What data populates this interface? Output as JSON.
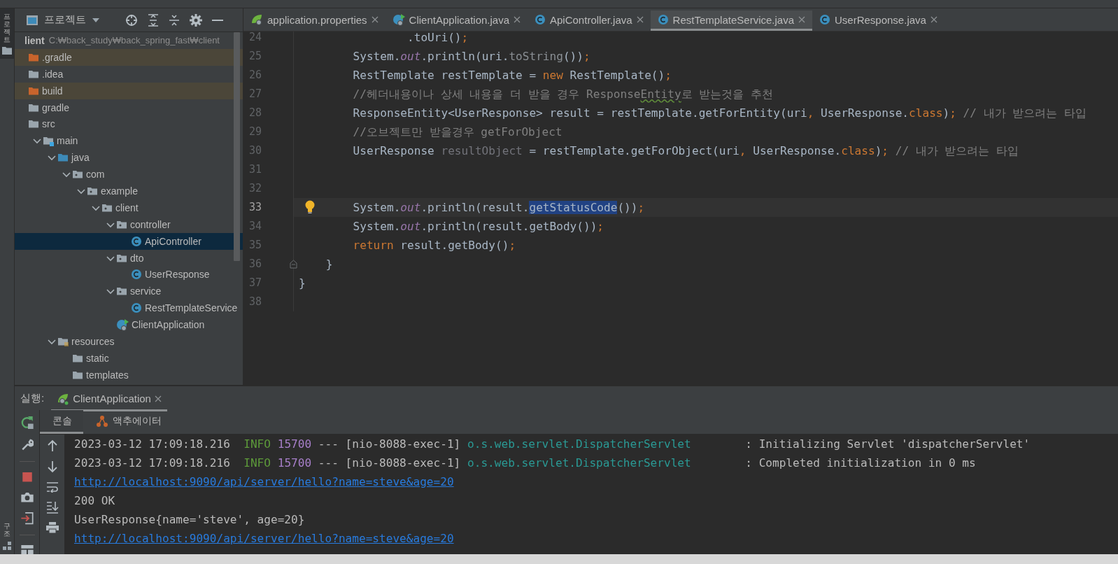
{
  "side_tabs": [
    {
      "label": "프로젝트",
      "selected": true
    },
    {
      "label": "구조",
      "selected": false
    }
  ],
  "project_panel": {
    "title": "프로젝트",
    "tree": [
      {
        "label": "lient",
        "path": "C:₩back_study₩back_spring_fast₩client",
        "selected": false,
        "children": [
          {
            "label": ".gradle",
            "kind": "excluded",
            "selected": false
          },
          {
            "label": ".idea",
            "kind": "folder",
            "selected": false
          },
          {
            "label": "build",
            "kind": "excluded",
            "selected": false
          },
          {
            "label": "gradle",
            "kind": "folder",
            "selected": false
          },
          {
            "label": "src",
            "kind": "folder",
            "selected": false,
            "children": [
              {
                "label": "main",
                "kind": "source",
                "expanded": true,
                "selected": false,
                "children": [
                  {
                    "label": "java",
                    "kind": "root",
                    "expanded": true,
                    "selected": false,
                    "children": [
                      {
                        "label": "com",
                        "kind": "package",
                        "expanded": true,
                        "selected": false,
                        "children": [
                          {
                            "label": "example",
                            "kind": "package",
                            "expanded": true,
                            "selected": false,
                            "children": [
                              {
                                "label": "client",
                                "kind": "package",
                                "expanded": true,
                                "selected": false,
                                "children": [
                                  {
                                    "label": "controller",
                                    "kind": "package",
                                    "expanded": true,
                                    "selected": false,
                                    "children": [
                                      {
                                        "label": "ApiController",
                                        "kind": "class",
                                        "selected": true
                                      }
                                    ]
                                  },
                                  {
                                    "label": "dto",
                                    "kind": "package",
                                    "expanded": true,
                                    "selected": false,
                                    "children": [
                                      {
                                        "label": "UserResponse",
                                        "kind": "class",
                                        "selected": false
                                      }
                                    ]
                                  },
                                  {
                                    "label": "service",
                                    "kind": "package",
                                    "expanded": true,
                                    "selected": false,
                                    "children": [
                                      {
                                        "label": "RestTemplateService",
                                        "kind": "class",
                                        "selected": false
                                      }
                                    ]
                                  },
                                  {
                                    "label": "ClientApplication",
                                    "kind": "app",
                                    "selected": false
                                  }
                                ]
                              }
                            ]
                          }
                        ]
                      }
                    ]
                  },
                  {
                    "label": "resources",
                    "kind": "resources",
                    "expanded": true,
                    "selected": false,
                    "children": [
                      {
                        "label": "static",
                        "kind": "folder",
                        "selected": false
                      },
                      {
                        "label": "templates",
                        "kind": "folder",
                        "selected": false
                      }
                    ]
                  }
                ]
              }
            ]
          }
        ]
      }
    ]
  },
  "editor_tabs": [
    {
      "label": "application.properties",
      "kind": "spring",
      "selected": false
    },
    {
      "label": "ClientApplication.java",
      "kind": "app",
      "selected": false
    },
    {
      "label": "ApiController.java",
      "kind": "class",
      "selected": false
    },
    {
      "label": "RestTemplateService.java",
      "kind": "class",
      "selected": true
    },
    {
      "label": "UserResponse.java",
      "kind": "class",
      "selected": false
    }
  ],
  "code_lines": [
    {
      "number": "24",
      "current": false,
      "bulb": false,
      "fold": false,
      "tokens": [
        {
          "t": "                .toUri()",
          "kind": "plain"
        },
        {
          "t": ";",
          "kind": "kw"
        }
      ]
    },
    {
      "number": "25",
      "current": false,
      "bulb": false,
      "fold": false,
      "tokens": [
        {
          "t": "        System.",
          "kind": "plain"
        },
        {
          "t": "out",
          "kind": "field"
        },
        {
          "t": ".println(uri.",
          "kind": "plain"
        },
        {
          "t": "toString",
          "kind": "inherited"
        },
        {
          "t": "())",
          "kind": "plain"
        },
        {
          "t": ";",
          "kind": "kw"
        }
      ]
    },
    {
      "number": "26",
      "current": false,
      "bulb": false,
      "fold": false,
      "tokens": [
        {
          "t": "        RestTemplate restTemplate = ",
          "kind": "plain"
        },
        {
          "t": "new",
          "kind": "kw"
        },
        {
          "t": " RestTemplate()",
          "kind": "plain"
        },
        {
          "t": ";",
          "kind": "kw"
        }
      ]
    },
    {
      "number": "27",
      "current": false,
      "bulb": false,
      "fold": false,
      "tokens": [
        {
          "t": "        //헤더내용이나 상세 내용을 더 받을 경우 Response",
          "kind": "comment"
        },
        {
          "t": "Entity",
          "kind": "typo"
        },
        {
          "t": "로 받는것을 추천",
          "kind": "comment"
        }
      ]
    },
    {
      "number": "28",
      "current": false,
      "bulb": false,
      "fold": false,
      "tokens": [
        {
          "t": "        ResponseEntity<UserResponse> result = restTemplate.getForEntity(uri",
          "kind": "plain"
        },
        {
          "t": ",",
          "kind": "kw"
        },
        {
          "t": " UserResponse.",
          "kind": "plain"
        },
        {
          "t": "class",
          "kind": "kw"
        },
        {
          "t": ")",
          "kind": "plain"
        },
        {
          "t": ";",
          "kind": "kw"
        },
        {
          "t": " // 내가 받으려는 타입",
          "kind": "comment"
        }
      ]
    },
    {
      "number": "29",
      "current": false,
      "bulb": false,
      "fold": false,
      "tokens": [
        {
          "t": "        //오브젝트만 받을경우 getForObject",
          "kind": "comment"
        }
      ]
    },
    {
      "number": "30",
      "current": false,
      "bulb": false,
      "fold": false,
      "tokens": [
        {
          "t": "        UserResponse ",
          "kind": "plain"
        },
        {
          "t": "resultObject",
          "kind": "unused"
        },
        {
          "t": " = restTemplate.getForObject(uri",
          "kind": "plain"
        },
        {
          "t": ",",
          "kind": "kw"
        },
        {
          "t": " UserResponse.",
          "kind": "plain"
        },
        {
          "t": "class",
          "kind": "kw"
        },
        {
          "t": ")",
          "kind": "plain"
        },
        {
          "t": ";",
          "kind": "kw"
        },
        {
          "t": " // 내가 받으려는 타입",
          "kind": "comment"
        }
      ]
    },
    {
      "number": "31",
      "current": false,
      "bulb": false,
      "fold": false
    },
    {
      "number": "32",
      "current": false,
      "bulb": false,
      "fold": false
    },
    {
      "number": "33",
      "current": true,
      "bulb": true,
      "fold": false,
      "tokens": [
        {
          "t": "        System.",
          "kind": "plain"
        },
        {
          "t": "out",
          "kind": "field"
        },
        {
          "t": ".println(result.",
          "kind": "plain"
        },
        {
          "t": "getStatusCode",
          "kind": "selection"
        },
        {
          "t": "())",
          "kind": "plain"
        },
        {
          "t": ";",
          "kind": "kw"
        }
      ]
    },
    {
      "number": "34",
      "current": false,
      "bulb": false,
      "fold": false,
      "tokens": [
        {
          "t": "        System.",
          "kind": "plain"
        },
        {
          "t": "out",
          "kind": "field"
        },
        {
          "t": ".println(result.getBody())",
          "kind": "plain"
        },
        {
          "t": ";",
          "kind": "kw"
        }
      ]
    },
    {
      "number": "35",
      "current": false,
      "bulb": false,
      "fold": false,
      "tokens": [
        {
          "t": "        return",
          "kind": "kw"
        },
        {
          "t": " result.getBody()",
          "kind": "plain"
        },
        {
          "t": ";",
          "kind": "kw"
        }
      ]
    },
    {
      "number": "36",
      "current": false,
      "bulb": false,
      "fold": true,
      "tokens": [
        {
          "t": "    }",
          "kind": "plain"
        }
      ]
    },
    {
      "number": "37",
      "current": false,
      "bulb": false,
      "fold": false,
      "tokens": [
        {
          "t": "}",
          "kind": "plain"
        }
      ]
    },
    {
      "number": "38",
      "current": false,
      "bulb": false,
      "fold": false
    }
  ],
  "run_panel": {
    "label": "실행:",
    "run_tabs": [
      {
        "label": "ClientApplication",
        "selected": true
      }
    ],
    "sub_tabs": [
      {
        "label": "콘솔",
        "selected": true
      },
      {
        "label": "액추에이터",
        "kind": "nodes",
        "selected": false
      }
    ],
    "console_lines": [
      {
        "kind": "log",
        "tokens": [
          {
            "t": "2023-03-12 17:09:18.216  ",
            "kind": "plain"
          },
          {
            "t": "INFO",
            "kind": "level"
          },
          {
            "t": " 15700",
            "kind": "pid"
          },
          {
            "t": " --- [nio-8088-exec-1] ",
            "kind": "plain"
          },
          {
            "t": "o.s.web.servlet.DispatcherServlet",
            "kind": "logger"
          },
          {
            "t": "        : Initializing Servlet 'dispatcherServlet'",
            "kind": "plain"
          }
        ]
      },
      {
        "kind": "log",
        "tokens": [
          {
            "t": "2023-03-12 17:09:18.216  ",
            "kind": "plain"
          },
          {
            "t": "INFO",
            "kind": "level"
          },
          {
            "t": " 15700",
            "kind": "pid"
          },
          {
            "t": " --- [nio-8088-exec-1] ",
            "kind": "plain"
          },
          {
            "t": "o.s.web.servlet.DispatcherServlet",
            "kind": "logger"
          },
          {
            "t": "        : Completed initialization in 0 ms",
            "kind": "plain"
          }
        ]
      },
      {
        "kind": "link",
        "text": "http://localhost:9090/api/server/hello?name=steve&age=20"
      },
      {
        "kind": "plain",
        "text": "200 OK"
      },
      {
        "kind": "plain",
        "text": "UserResponse{name='steve', age=20}"
      },
      {
        "kind": "link",
        "text": "http://localhost:9090/api/server/hello?name=steve&age=20"
      }
    ]
  }
}
